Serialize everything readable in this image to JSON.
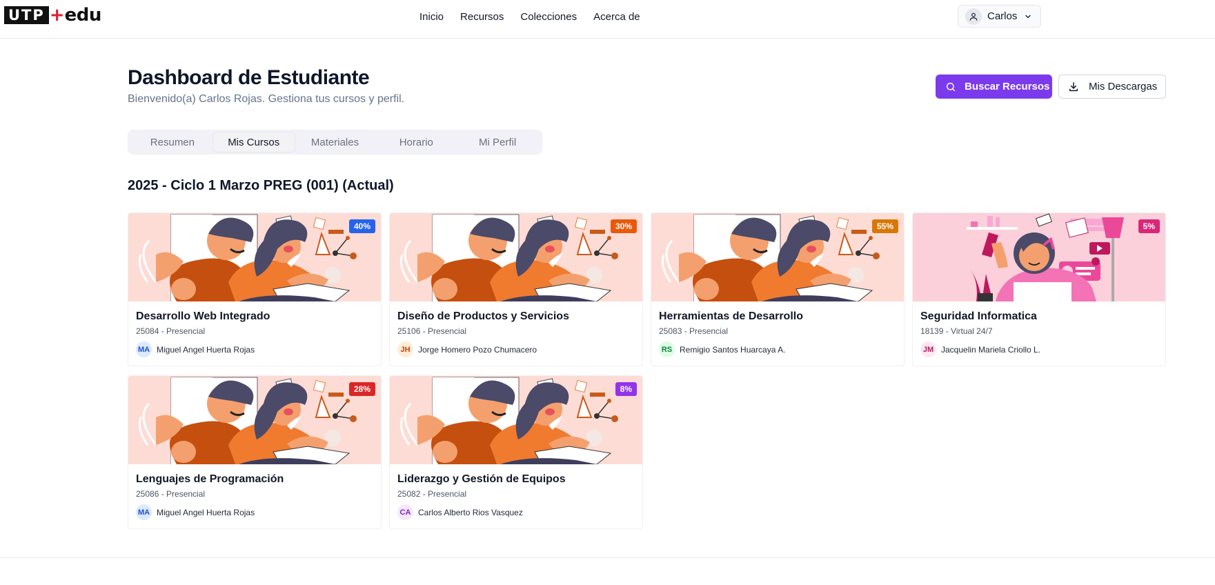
{
  "header": {
    "logo": {
      "part1": "UTP",
      "plus": "+",
      "part2": "edu"
    },
    "nav": [
      "Inicio",
      "Recursos",
      "Colecciones",
      "Acerca de"
    ],
    "user": {
      "name": "Carlos",
      "icon": "user-icon",
      "chevron": "chevron-down-icon"
    }
  },
  "page": {
    "title": "Dashboard de Estudiante",
    "subtitle": "Bienvenido(a) Carlos Rojas. Gestiona tus cursos y perfil.",
    "search_button": "Buscar Recursos",
    "downloads_button": "Mis Descargas"
  },
  "tabs": [
    {
      "label": "Resumen",
      "active": false
    },
    {
      "label": "Mis Cursos",
      "active": true
    },
    {
      "label": "Materiales",
      "active": false
    },
    {
      "label": "Horario",
      "active": false
    },
    {
      "label": "Mi Perfil",
      "active": false
    }
  ],
  "section_title": "2025 - Ciclo 1 Marzo PREG (001) (Actual)",
  "courses": [
    {
      "name": "Desarrollo Web Integrado",
      "code": "25084 - Presencial",
      "teacher": "Miguel Angel Huerta Rojas",
      "initials": "MA",
      "progress": "40%",
      "progress_value": 0.4,
      "badge_color": "#2563eb",
      "ini_bg": "#dbeafe",
      "ini_fg": "#1d4ed8",
      "image": "students-illustration"
    },
    {
      "name": "Diseño de Productos y Servicios",
      "code": "25106 - Presencial",
      "teacher": "Jorge Homero Pozo Chumacero",
      "initials": "JH",
      "progress": "30%",
      "progress_value": 0.3,
      "badge_color": "#ea580c",
      "ini_bg": "#ffedd5",
      "ini_fg": "#c2410c",
      "image": "students-illustration"
    },
    {
      "name": "Herramientas de Desarrollo",
      "code": "25083 - Presencial",
      "teacher": "Remigio Santos Huarcaya A.",
      "initials": "RS",
      "progress": "55%",
      "progress_value": 0.55,
      "badge_color": "#d97706",
      "ini_bg": "#dcfce7",
      "ini_fg": "#15803d",
      "image": "students-illustration"
    },
    {
      "name": "Seguridad Informatica",
      "code": "18139 - Virtual 24/7",
      "teacher": "Jacquelin Mariela Criollo L.",
      "initials": "JM",
      "progress": "5%",
      "progress_value": 0.05,
      "badge_color": "#db2777",
      "ini_bg": "#fce7f3",
      "ini_fg": "#be185d",
      "image": "selfie-illustration"
    },
    {
      "name": "Lenguajes de Programación",
      "code": "25086 - Presencial",
      "teacher": "Miguel Angel Huerta Rojas",
      "initials": "MA",
      "progress": "28%",
      "progress_value": 0.28,
      "badge_color": "#dc2626",
      "ini_bg": "#dbeafe",
      "ini_fg": "#1d4ed8",
      "image": "students-illustration"
    },
    {
      "name": "Liderazgo y Gestión de Equipos",
      "code": "25082 - Presencial",
      "teacher": "Carlos Alberto Rios Vasquez",
      "initials": "CA",
      "progress": "8%",
      "progress_value": 0.08,
      "badge_color": "#9333ea",
      "ini_bg": "#f3e8ff",
      "ini_fg": "#7e22ce",
      "image": "students-illustration"
    }
  ]
}
